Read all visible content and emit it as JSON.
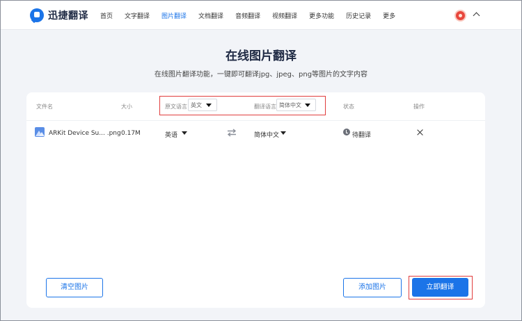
{
  "brand": {
    "name": "迅捷翻译"
  },
  "nav": {
    "items": [
      {
        "label": "首页"
      },
      {
        "label": "文字翻译"
      },
      {
        "label": "图片翻译"
      },
      {
        "label": "文档翻译"
      },
      {
        "label": "音频翻译"
      },
      {
        "label": "视频翻译"
      },
      {
        "label": "更多功能"
      },
      {
        "label": "历史记录"
      },
      {
        "label": "更多"
      }
    ],
    "active": "图片翻译"
  },
  "page": {
    "title": "在线图片翻译",
    "subtitle": "在线图片翻译功能，一键即可翻译jpg、jpeg、png等图片的文字内容"
  },
  "table": {
    "headers": {
      "file_name": "文件名",
      "size": "大小",
      "source_lang": "原文语言",
      "target_lang": "翻译语言",
      "status": "状态",
      "action": "操作"
    },
    "source_select": "英文",
    "target_select": "简体中文",
    "rows": [
      {
        "file_name": "ARKit Device Su... .png",
        "size": "0.17M",
        "source_lang": "英语",
        "target_lang": "简体中文",
        "status": "待翻译"
      }
    ]
  },
  "buttons": {
    "clear": "清空图片",
    "add": "添加图片",
    "translate": "立即翻译"
  },
  "colors": {
    "accent": "#1b74e8",
    "highlight": "#e03c3c"
  }
}
